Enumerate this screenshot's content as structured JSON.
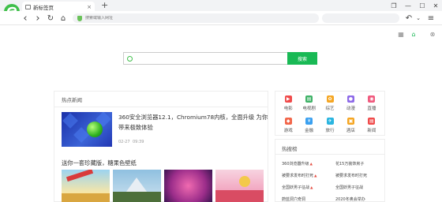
{
  "browser": {
    "tab_title": "新标签页",
    "tab_close": "×",
    "new_tab": "+",
    "address_placeholder": "搜索或输入网址",
    "window_controls": {
      "restore": "❐",
      "minimize": "—",
      "maximize": "☐",
      "close": "✕"
    }
  },
  "nav": {
    "back": "‹",
    "forward": "›",
    "refresh": "↻",
    "home": "⌂",
    "undo": "↶",
    "dropdown": "⌄",
    "menu": "≡"
  },
  "toolbar_icons": [
    "grid-icon",
    "skin-icon",
    "settings-icon"
  ],
  "search": {
    "placeholder": "",
    "button": "搜索"
  },
  "news": {
    "section_title": "热点新闻",
    "headline": "360安全浏览器12.1，Chromium78内核，全面升级 为你带来极致体验",
    "date": "02-27",
    "time": "09:39",
    "wallpaper_title": "送你一套珍藏版，糖果色壁纸"
  },
  "apps": [
    {
      "label": "电影",
      "color": "#f04b4b"
    },
    {
      "label": "电视剧",
      "color": "#3fb267"
    },
    {
      "label": "综艺",
      "color": "#f5a623"
    },
    {
      "label": "动漫",
      "color": "#8e6ae8"
    },
    {
      "label": "直播",
      "color": "#f05a7e"
    },
    {
      "label": "游戏",
      "color": "#f2664a"
    },
    {
      "label": "金融",
      "color": "#3aa0f0"
    },
    {
      "label": "旅行",
      "color": "#2bb5e0"
    },
    {
      "label": "酒店",
      "color": "#f5a623"
    },
    {
      "label": "新闻",
      "color": "#f04b4b"
    }
  ],
  "hot": {
    "title": "热搜榜",
    "items": [
      {
        "text": "360浏览器升级",
        "tag": "▲"
      },
      {
        "text": "花15万装饰房子",
        "tag": ""
      },
      {
        "text": "被要求发布时打死",
        "tag": "▲"
      },
      {
        "text": "被要求发布时打死",
        "tag": ""
      },
      {
        "text": "全国妖男子征战",
        "tag": "▲"
      },
      {
        "text": "全国妖男子征战",
        "tag": ""
      },
      {
        "text": "蔚蓝洞穴奇洞",
        "tag": ""
      },
      {
        "text": "2020冬奥会举办",
        "tag": ""
      }
    ]
  },
  "colors": {
    "accent": "#19b955",
    "brand_logo": "#3fbf4a"
  }
}
